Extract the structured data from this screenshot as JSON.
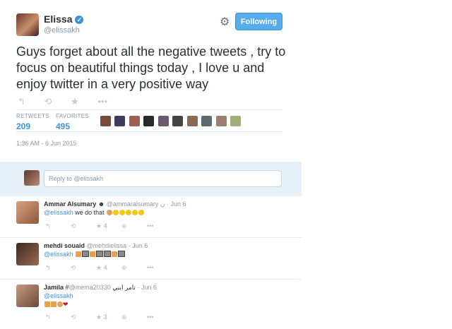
{
  "user": {
    "name": "Elissa",
    "handle": "@elissakh",
    "follow_label": "Following"
  },
  "tweet": {
    "text": "Guys forget about all the negative tweets , try to focus on beautiful things today , I love u and enjoy twitter in a very positive way",
    "actions": [
      "↰",
      "⟲",
      "★",
      "•••"
    ],
    "timestamp": "1:36 AM - 6 Jun 2015"
  },
  "stats": {
    "retweets_label": "RETWEETS",
    "retweets": "209",
    "favorites_label": "FAVORITES",
    "favorites": "495"
  },
  "reply_box": {
    "placeholder": "Reply to @elissakh"
  },
  "replies": [
    {
      "name": "Ammar Alsumary",
      "badge": "☻",
      "handle": "@ammaralsumary",
      "handle_suffix": "ن",
      "date": "· Jun 6",
      "mention": "@elissakh",
      "text": " we do that ",
      "fav_count": "4"
    },
    {
      "name": "mehdi souaid",
      "badge": "",
      "handle": "@mehdielissa",
      "handle_suffix": "",
      "date": "· Jun 6",
      "mention": "@elissakh",
      "text": " ",
      "fav_count": "4"
    },
    {
      "name": "Jamila",
      "badge": "#",
      "handle": "@mema20330",
      "handle_suffix": "تامر ابني",
      "date": "· Jun 6",
      "mention": "@elissakh",
      "text": "",
      "fav_count": "3"
    }
  ],
  "colors": {
    "accent": "#55acee",
    "link": "#3b94d9",
    "reply_bg": "#e8f1f8"
  }
}
